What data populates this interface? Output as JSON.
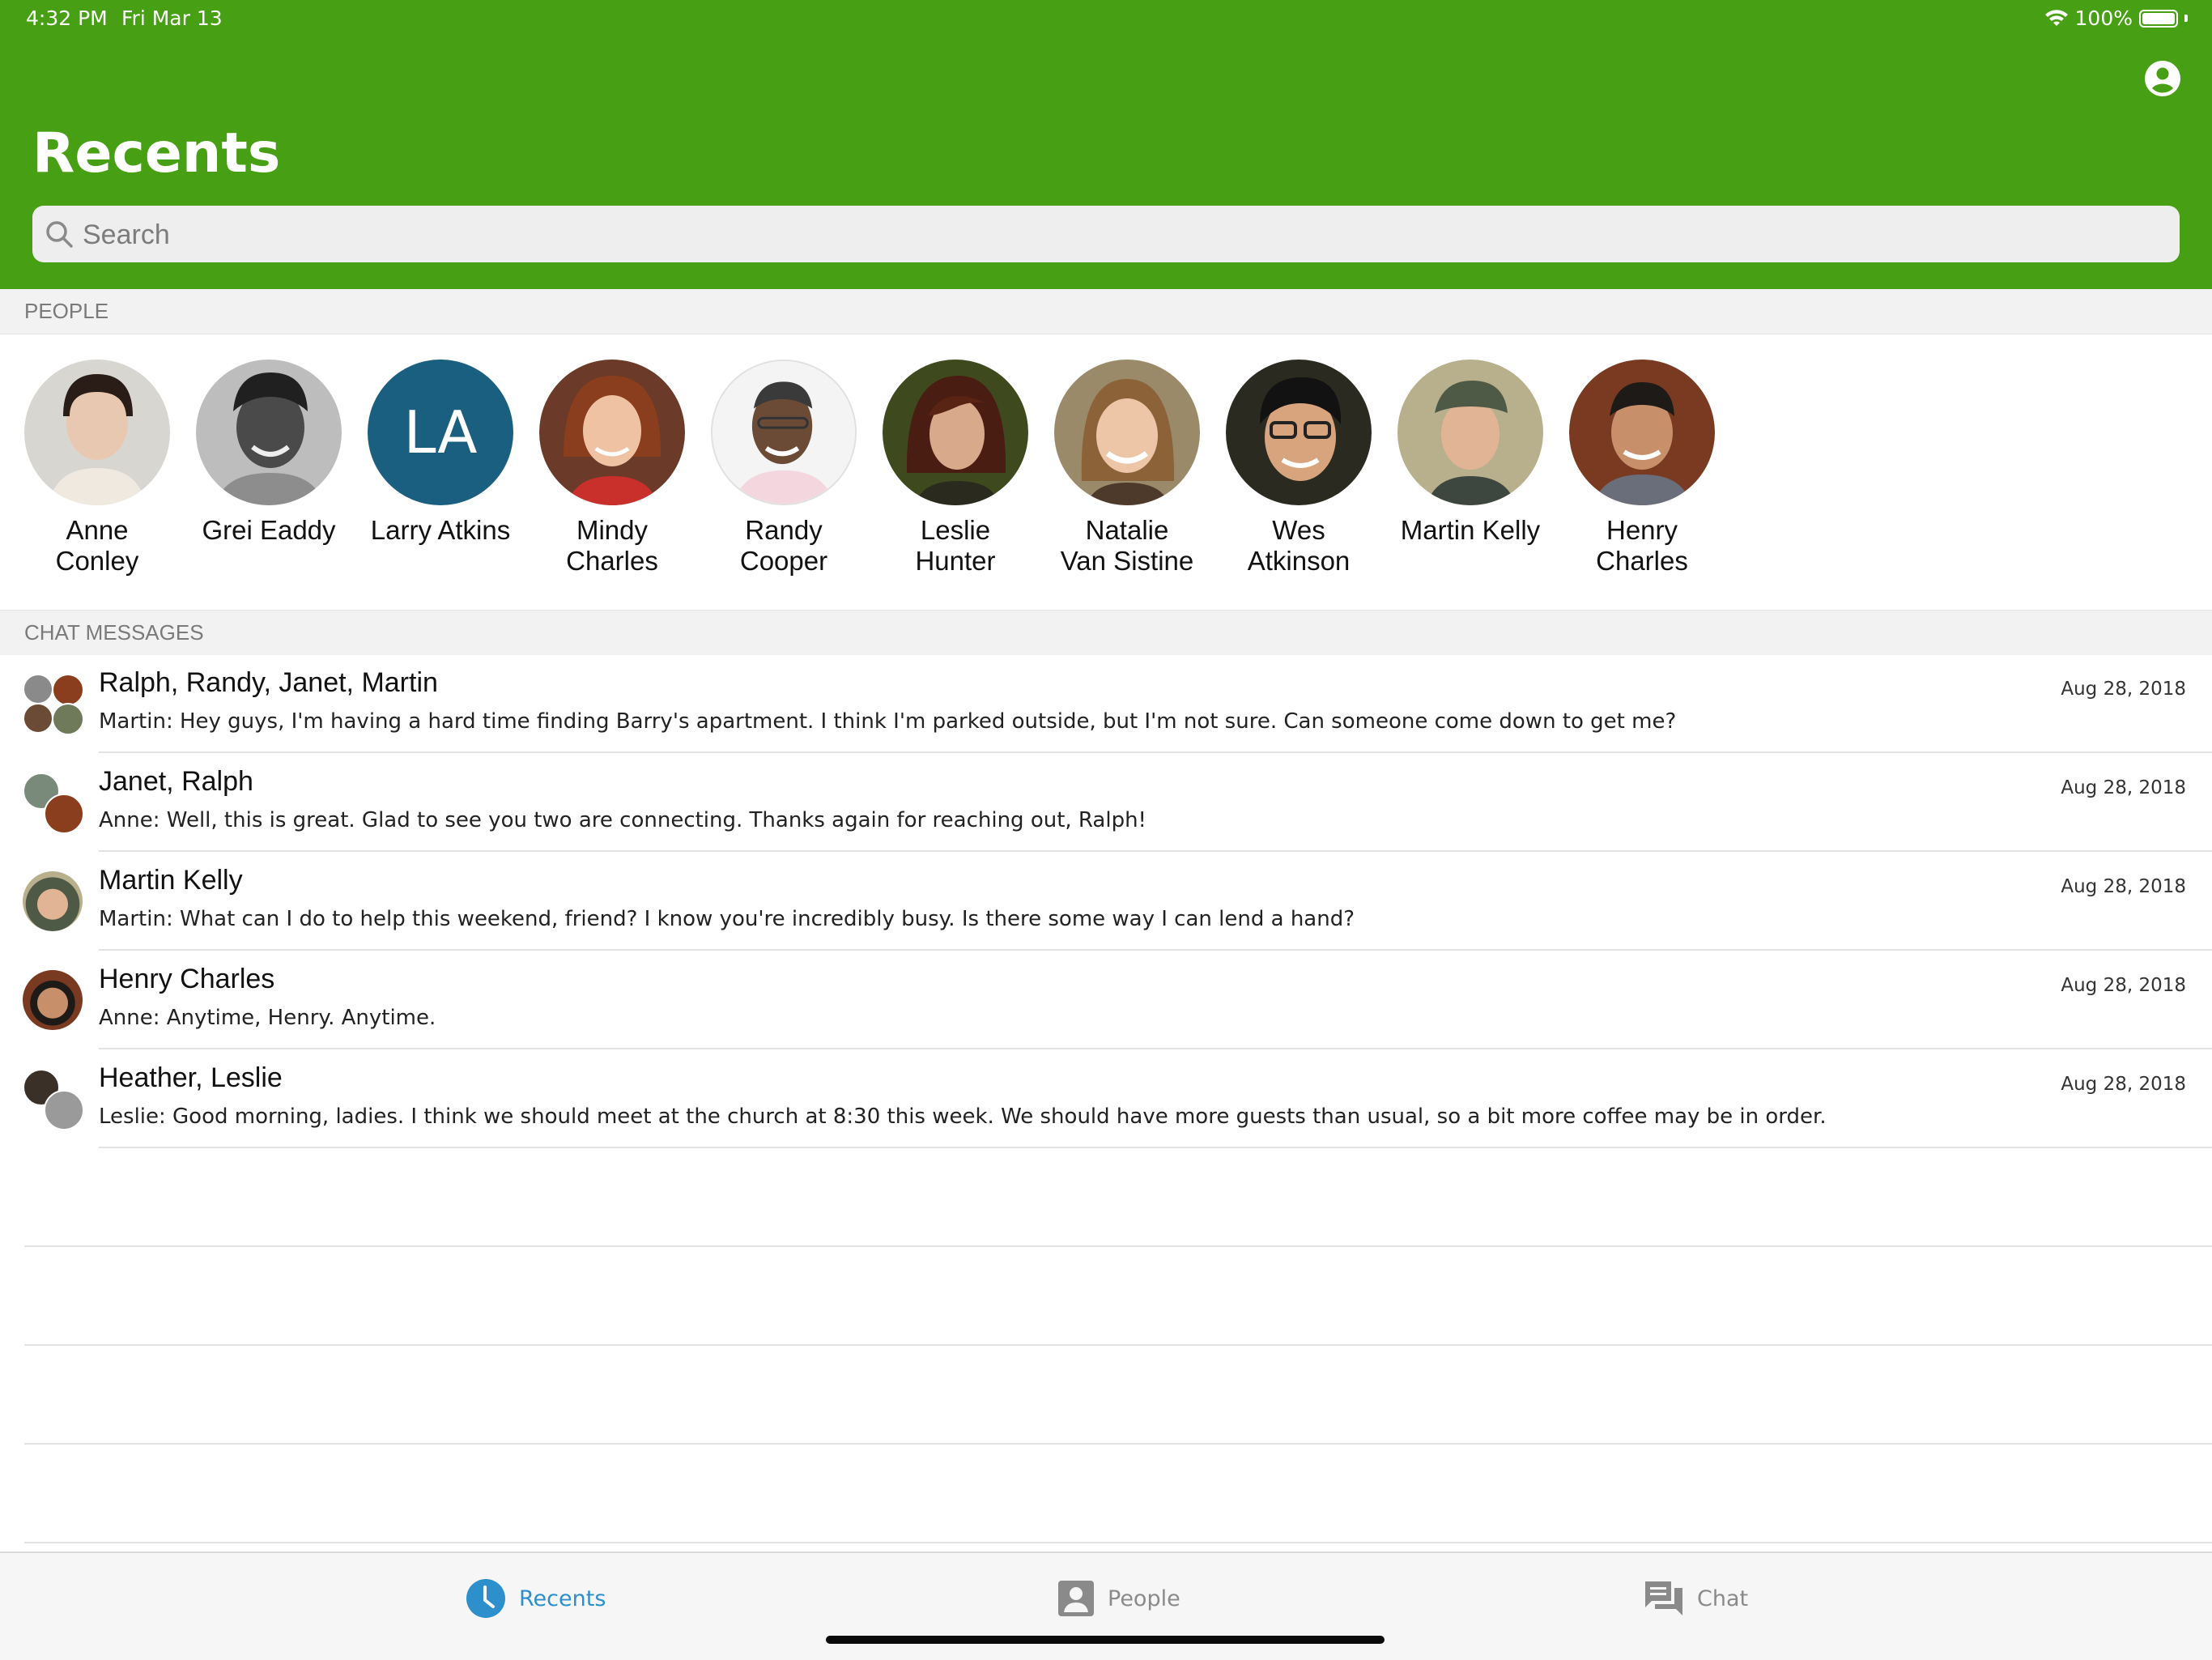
{
  "status_bar": {
    "time": "4:32 PM",
    "date": "Fri Mar 13",
    "battery": "100%"
  },
  "header": {
    "title": "Recents",
    "profile_icon": "person-circle-icon"
  },
  "search": {
    "placeholder": "Search"
  },
  "people_section": {
    "title": "PEOPLE",
    "people": [
      {
        "line1": "Anne",
        "line2": "Conley"
      },
      {
        "line1": "Grei Eaddy",
        "line2": ""
      },
      {
        "line1": "Larry Atkins",
        "line2": "",
        "initials": "LA"
      },
      {
        "line1": "Mindy",
        "line2": "Charles"
      },
      {
        "line1": "Randy",
        "line2": "Cooper"
      },
      {
        "line1": "Leslie",
        "line2": "Hunter"
      },
      {
        "line1": "Natalie",
        "line2": "Van Sistine"
      },
      {
        "line1": "Wes",
        "line2": "Atkinson"
      },
      {
        "line1": "Martin Kelly",
        "line2": ""
      },
      {
        "line1": "Henry",
        "line2": "Charles"
      }
    ]
  },
  "chat_section": {
    "title": "CHAT MESSAGES",
    "chats": [
      {
        "title": "Ralph, Randy, Janet, Martin",
        "snippet": "Martin: Hey guys, I'm having a hard time finding Barry's apartment. I think I'm parked outside, but I'm not sure. Can someone come down to get me?",
        "date": "Aug 28, 2018"
      },
      {
        "title": "Janet, Ralph",
        "snippet": "Anne: Well, this is great. Glad to see you two are connecting. Thanks again for reaching out, Ralph!",
        "date": "Aug 28, 2018"
      },
      {
        "title": "Martin Kelly",
        "snippet": "Martin: What can I do to help this weekend, friend? I know you're incredibly busy. Is there some way I can lend a hand?",
        "date": "Aug 28, 2018"
      },
      {
        "title": "Henry Charles",
        "snippet": "Anne: Anytime, Henry. Anytime.",
        "date": "Aug 28, 2018"
      },
      {
        "title": "Heather, Leslie",
        "snippet": "Leslie: Good morning, ladies. I think we should meet at the church at 8:30 this week. We should have more guests than usual, so a bit more coffee may be in order.",
        "date": "Aug 28, 2018"
      }
    ]
  },
  "tabs": [
    {
      "label": "Recents",
      "icon": "clock-icon",
      "active": true
    },
    {
      "label": "People",
      "icon": "person-card-icon",
      "active": false
    },
    {
      "label": "Chat",
      "icon": "chat-bubbles-icon",
      "active": false
    }
  ],
  "colors": {
    "header": "#47a014",
    "active_tab": "#2d8fcc",
    "initials_bg": "#1a5e80"
  }
}
